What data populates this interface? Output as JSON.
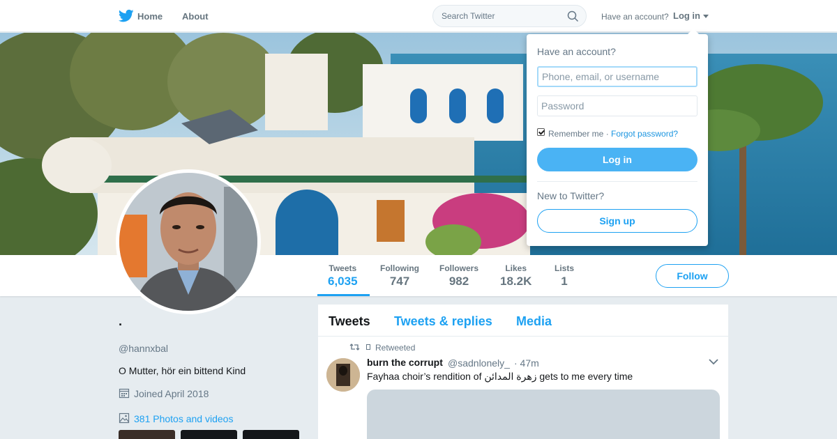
{
  "nav": {
    "home": "Home",
    "about": "About",
    "search_placeholder": "Search Twitter",
    "have_account": "Have an account?",
    "login": "Log in"
  },
  "profile": {
    "display_name": "·",
    "handle": "@hannxbal",
    "bio": "O Mutter, hör ein bittend Kind",
    "joined": "Joined April 2018",
    "photos": "381 Photos and videos"
  },
  "stats": [
    {
      "label": "Tweets",
      "value": "6,035"
    },
    {
      "label": "Following",
      "value": "747"
    },
    {
      "label": "Followers",
      "value": "982"
    },
    {
      "label": "Likes",
      "value": "18.2K"
    },
    {
      "label": "Lists",
      "value": "1"
    }
  ],
  "follow_label": "Follow",
  "timeline": {
    "tabs": [
      "Tweets",
      "Tweets & replies",
      "Media"
    ],
    "tweet": {
      "retweeted_label": "Retweeted",
      "name": "burn the corrupt",
      "handle": "@sadnlonely_",
      "time": "· 47m",
      "text": "Fayhaa choir’s rendition of زهرة المدائن gets to me every time"
    }
  },
  "login_dropdown": {
    "heading": "Have an account?",
    "username_placeholder": "Phone, email, or username",
    "password_placeholder": "Password",
    "remember": "Remember me ·",
    "forgot": "Forgot password?",
    "login_button": "Log in",
    "new_to_twitter": "New to Twitter?",
    "signup_button": "Sign up"
  },
  "colors": {
    "accent": "#1da1f2",
    "login_button": "#4ab3f4",
    "background": "#e6ecf0"
  }
}
